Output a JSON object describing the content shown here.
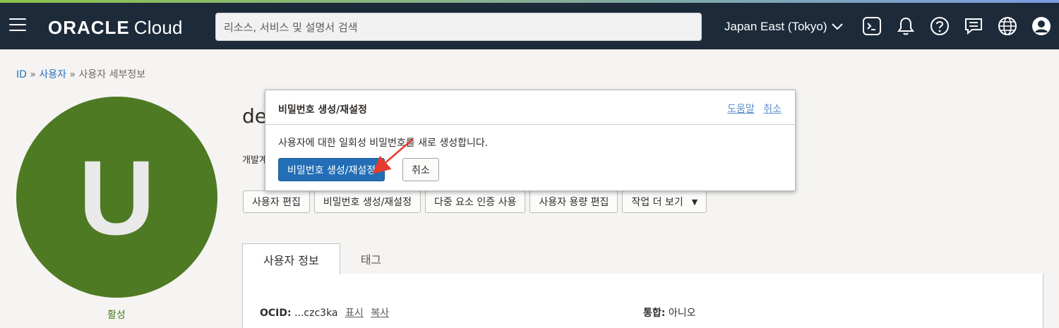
{
  "header": {
    "logo_bold": "ORACLE",
    "logo_light": "Cloud",
    "search_placeholder": "리소스, 서비스 및 설명서 검색",
    "region": "Japan East (Tokyo)"
  },
  "breadcrumb": {
    "root": "ID",
    "users": "사용자",
    "current": "사용자 세부정보",
    "separator": "»"
  },
  "user": {
    "avatar_letter": "U",
    "status": "활성",
    "name": "de",
    "description": "개발계"
  },
  "actions": [
    {
      "label": "사용자 편집"
    },
    {
      "label": "비밀번호 생성/재설정"
    },
    {
      "label": "다중 요소 인증 사용"
    },
    {
      "label": "사용자 용량 편집"
    },
    {
      "label": "작업 더 보기"
    }
  ],
  "tabs": [
    {
      "label": "사용자 정보"
    },
    {
      "label": "태그"
    }
  ],
  "info": {
    "ocid_label": "OCID:",
    "ocid_value": "...czc3ka",
    "show_link": "표시",
    "copy_link": "복사",
    "federated_label": "통합:",
    "federated_value": "아니오"
  },
  "modal": {
    "title": "비밀번호 생성/재설정",
    "help_link": "도움말",
    "cancel_link": "취소",
    "body": "사용자에 대한 일회성 비밀번호를 새로 생성합니다.",
    "primary_button": "비밀번호 생성/재설정",
    "cancel_button": "취소"
  },
  "colors": {
    "topbar": "#1c2a3a",
    "avatar": "#4e7a23",
    "primary": "#236eb6",
    "annotation_arrow": "#e53b2f"
  },
  "icons": [
    "menu-icon",
    "cloud-shell-icon",
    "bell-icon",
    "help-icon",
    "chat-icon",
    "globe-icon",
    "user-profile-icon",
    "chevron-down-icon",
    "caret-down-icon"
  ]
}
